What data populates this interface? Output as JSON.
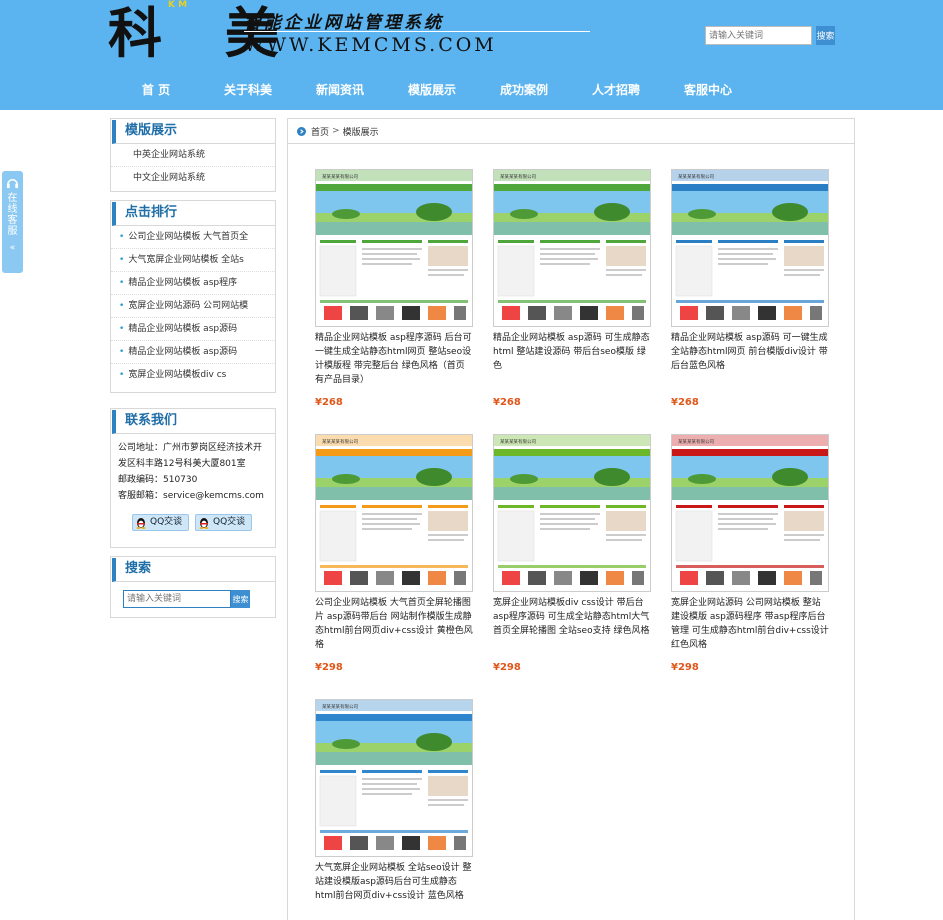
{
  "header": {
    "logo_text": "科 美",
    "logo_tag": "K M",
    "slogan": "智能企业网站管理系统",
    "url": "WWW.KEMCMS.COM",
    "search_placeholder": "请输入关键词",
    "search_button": "搜索"
  },
  "nav": [
    {
      "label": "首 页"
    },
    {
      "label": "关于科美"
    },
    {
      "label": "新闻资讯"
    },
    {
      "label": "模版展示"
    },
    {
      "label": "成功案例"
    },
    {
      "label": "人才招聘"
    },
    {
      "label": "客服中心"
    }
  ],
  "float_service": {
    "label": "在线客服",
    "arrow": "«"
  },
  "sidebar": {
    "category": {
      "title": "模版展示",
      "items": [
        "中英企业网站系统",
        "中文企业网站系统"
      ]
    },
    "ranking": {
      "title": "点击排行",
      "items": [
        "公司企业网站模板 大气首页全",
        "大气宽屏企业网站模板 全站s",
        "精品企业网站模板 asp程序",
        "宽屏企业网站源码 公司网站模",
        "精品企业网站模板 asp源码",
        "精品企业网站模板 asp源码",
        "宽屏企业网站模板div cs"
      ]
    },
    "contact": {
      "title": "联系我们",
      "address_line1": "公司地址：广州市萝岗区经济技术开",
      "address_line2": "发区科丰路12号科美大厦801室",
      "postcode": "邮政编码：510730",
      "email": "客服邮箱：service@kemcms.com",
      "qq1": "QQ交谈",
      "qq2": "QQ交谈"
    },
    "search": {
      "title": "搜索",
      "placeholder": "请输入关键词",
      "button": "搜索"
    }
  },
  "breadcrumb": {
    "home": "首页",
    "sep": ">",
    "current": "模版展示"
  },
  "products": [
    {
      "title": "精品企业网站模板 asp程序源码 后台可一键生成全站静态html网页 整站seo设计模版程 带完整后台 绿色风格（首页有产品目录）",
      "price": "¥268",
      "theme": "#4fa63a"
    },
    {
      "title": "精品企业网站模板 asp源码 可生成静态html 整站建设源码 带后台seo模版 绿色",
      "price": "¥268",
      "theme": "#4fa63a"
    },
    {
      "title": "精品企业网站模板 asp源码 可一键生成全站静态html网页 前台模版div设计 带后台蓝色风格",
      "price": "¥268",
      "theme": "#2a7fc4"
    },
    {
      "title": "公司企业网站模板 大气首页全屏轮播图片 asp源码带后台 网站制作模版生成静态html前台网页div+css设计 黄橙色风格",
      "price": "¥298",
      "theme": "#f39a16"
    },
    {
      "title": "宽屏企业网站模板div css设计 带后台asp程序源码 可生成全站静态html大气首页全屏轮播图 全站seo支持 绿色风格",
      "price": "¥298",
      "theme": "#6cb82a"
    },
    {
      "title": "宽屏企业网站源码 公司网站模板 整站建设模版 asp源码程序 带asp程序后台管理 可生成静态html前台div+css设计 红色风格",
      "price": "¥298",
      "theme": "#c81818"
    },
    {
      "title": "大气宽屏企业网站模板 全站seo设计 整站建设模版asp源码后台可生成静态html前台网页div+css设计 蓝色风格",
      "price": "¥298",
      "theme": "#2f86cc"
    }
  ],
  "thumb_text": {
    "company": "某某某某有限公司"
  }
}
